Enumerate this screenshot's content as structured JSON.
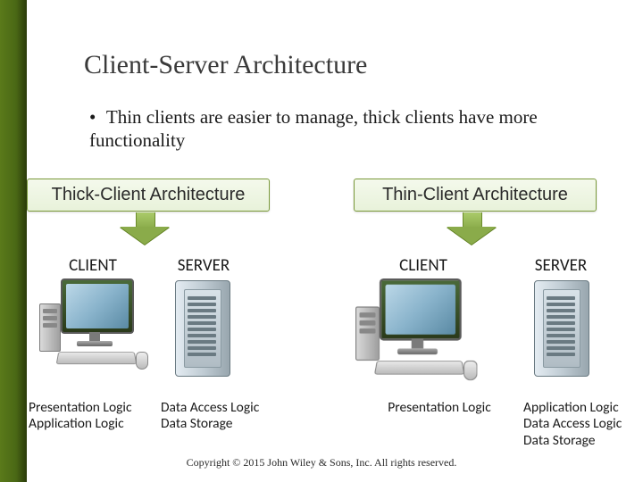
{
  "title": "Client-Server Architecture",
  "bullet": "Thin clients are easier to manage, thick clients have more functionality",
  "arch": {
    "thick": "Thick-Client Architecture",
    "thin": "Thin-Client Architecture"
  },
  "labels": {
    "client": "CLIENT",
    "server": "SERVER"
  },
  "logic": {
    "thick_client": [
      "Presentation Logic",
      "Application Logic"
    ],
    "thick_server": [
      "Data Access Logic",
      "Data Storage"
    ],
    "thin_client": [
      "Presentation Logic"
    ],
    "thin_server": [
      "Application Logic",
      "Data Access Logic",
      "Data Storage"
    ]
  },
  "footer": "Copyright © 2015 John Wiley & Sons, Inc. All rights reserved."
}
